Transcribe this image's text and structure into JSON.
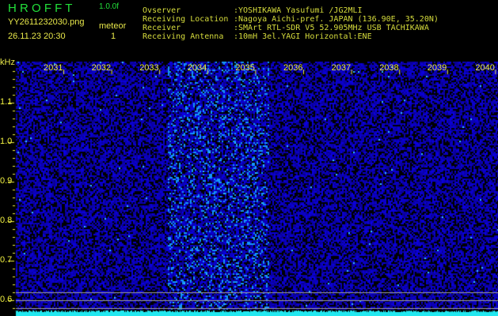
{
  "app": {
    "name": "H R O F F T",
    "version": "1.0.0f"
  },
  "file": {
    "name": "YY2611232030.png",
    "datetime": "26.11.23 20:30"
  },
  "meteor": {
    "label": "meteor",
    "count": "1"
  },
  "info": {
    "observer_label": "Ovserver",
    "observer": ":YOSHIKAWA Yasufumi /JG2MLI",
    "location_label": "Receiving Location",
    "location": ":Nagoya Aichi-pref. JAPAN (136.90E, 35.20N)",
    "receiver_label": "Receiver",
    "receiver": ":SMArt RTL-SDR V5 52.905MHz USB TACHIKAWA",
    "antenna_label": "Receiving Antenna",
    "antenna": ":10mH 3el.YAGI Horizontal:ENE"
  },
  "axis": {
    "y_unit": "kHz",
    "x_ticks": [
      "2031",
      "2032",
      "2033",
      "2034",
      "2035",
      "2036",
      "2037",
      "2038",
      "2039",
      "2040"
    ],
    "y_ticks": [
      "1.1",
      "1.0",
      "0.9",
      "0.8",
      "0.7",
      "0.6"
    ]
  },
  "colors": {
    "text": "#e8e84a",
    "title": "#22e03a",
    "background": "#000000",
    "noise": "#1a1ae0",
    "level": "#22e8f0"
  }
}
